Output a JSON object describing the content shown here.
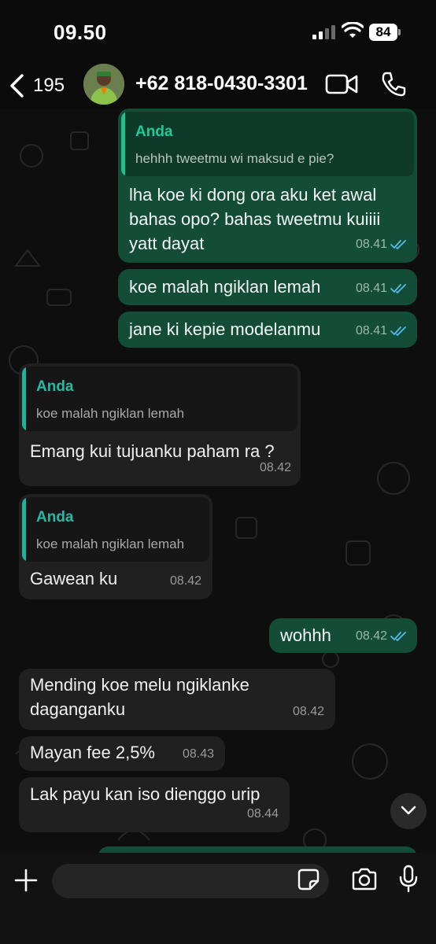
{
  "status_bar": {
    "time": "09.50",
    "battery_level": "84"
  },
  "header": {
    "back_count": "195",
    "contact_name": "+62 818-0430-3301"
  },
  "messages": [
    {
      "direction": "outgoing",
      "quote": {
        "author": "Anda",
        "text": "hehhh tweetmu wi maksud e pie?"
      },
      "lines": [
        "lha koe ki dong ora aku ket awal",
        "bahas opo? bahas tweetmu kuiiii",
        "yatt dayat"
      ],
      "time": "08.41",
      "read": true
    },
    {
      "direction": "outgoing",
      "lines": [
        "koe malah ngiklan lemah"
      ],
      "time": "08.41",
      "read": true
    },
    {
      "direction": "outgoing",
      "lines": [
        "jane ki kepie modelanmu"
      ],
      "time": "08.41",
      "read": true
    },
    {
      "direction": "incoming",
      "quote": {
        "author": "Anda",
        "text": "koe malah ngiklan lemah"
      },
      "lines": [
        "Emang kui tujuanku paham ra ?"
      ],
      "time": "08.42"
    },
    {
      "direction": "incoming",
      "quote": {
        "author": "Anda",
        "text": "koe malah ngiklan lemah"
      },
      "lines": [
        "Gawean ku"
      ],
      "time": "08.42"
    },
    {
      "direction": "outgoing",
      "lines": [
        "wohhh"
      ],
      "time": "08.42",
      "read": true
    },
    {
      "direction": "incoming",
      "lines": [
        "Mending koe melu ngiklanke",
        "daganganku"
      ],
      "time": "08.42"
    },
    {
      "direction": "incoming",
      "lines": [
        "Mayan fee 2,5%"
      ],
      "time": "08.43"
    },
    {
      "direction": "incoming",
      "lines": [
        "Lak payu kan iso dienggo urip"
      ],
      "time": "08.44"
    }
  ],
  "input": {
    "placeholder": ""
  },
  "icons": {
    "back": "chevron-left-icon",
    "video": "video-camera-icon",
    "call": "phone-icon",
    "plus": "plus-icon",
    "sticker": "sticker-icon",
    "camera": "camera-icon",
    "mic": "microphone-icon",
    "scroll": "chevron-down-icon",
    "read_receipt": "double-check-icon"
  },
  "colors": {
    "outgoing_bubble": "#144d37",
    "incoming_bubble": "#202020",
    "quote_accent": "#21c18b",
    "read_tick": "#53bdeb"
  }
}
